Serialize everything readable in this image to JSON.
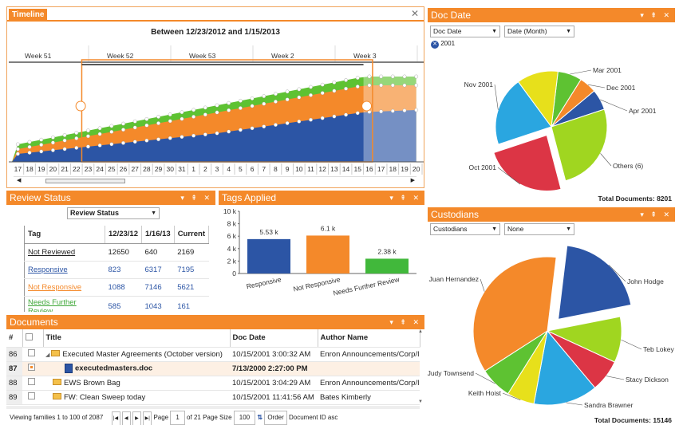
{
  "timeline": {
    "tab": "Timeline",
    "range_title": "Between 12/23/2012 and 1/15/2013",
    "weeks": [
      "Week 51",
      "Week 52",
      "Week 53",
      "Week 2",
      "Week 3"
    ],
    "days": [
      "17",
      "18",
      "19",
      "20",
      "21",
      "22",
      "23",
      "24",
      "25",
      "26",
      "27",
      "28",
      "29",
      "30",
      "31",
      "1",
      "2",
      "3",
      "4",
      "5",
      "6",
      "7",
      "8",
      "9",
      "10",
      "11",
      "12",
      "13",
      "14",
      "15",
      "16",
      "17",
      "18",
      "19",
      "20"
    ]
  },
  "doc_date": {
    "title": "Doc Date",
    "select1": "Doc Date",
    "select2": "Date (Month)",
    "filter_chip": "2001",
    "total_label": "Total Documents:",
    "total_value": "8201",
    "chart_data": {
      "type": "pie",
      "slices": [
        {
          "label": "Mar 2001",
          "value": 7,
          "color": "#5ec232"
        },
        {
          "label": "Dec 2001",
          "value": 5,
          "color": "#f4892a"
        },
        {
          "label": "Apr 2001",
          "value": 6,
          "color": "#2c55a5"
        },
        {
          "label": "Others (6)",
          "value": 26,
          "color": "#a0d620"
        },
        {
          "label": "Oct 2001",
          "value": 24,
          "color": "#dc3545"
        },
        {
          "label": "Nov 2001",
          "value": 20,
          "color": "#2aa6e0"
        },
        {
          "label": "",
          "value": 12,
          "color": "#e7e01b"
        }
      ]
    }
  },
  "review": {
    "title": "Review Status",
    "select": "Review Status",
    "headers": [
      "Tag",
      "12/23/12",
      "1/16/13",
      "Current"
    ],
    "rows": [
      {
        "tag": "Not Reviewed",
        "a": "12650",
        "b": "640",
        "c": "2169",
        "color": "#222"
      },
      {
        "tag": "Responsive",
        "a": "823",
        "b": "6317",
        "c": "7195",
        "color": "#2c55a5"
      },
      {
        "tag": "Not Responsive",
        "a": "1088",
        "b": "7146",
        "c": "5621",
        "color": "#f4892a"
      },
      {
        "tag": "Needs Further Review",
        "a": "585",
        "b": "1043",
        "c": "161",
        "color": "#41a83b"
      }
    ]
  },
  "tags": {
    "title": "Tags Applied",
    "chart_data": {
      "type": "bar",
      "categories": [
        "Responsive",
        "Not Responsive",
        "Needs Further Review"
      ],
      "values": [
        5.53,
        6.1,
        2.38
      ],
      "value_labels": [
        "5.53 k",
        "6.1 k",
        "2.38 k"
      ],
      "colors": [
        "#2c55a5",
        "#f4892a",
        "#41b83b"
      ],
      "yticks": [
        "0",
        "2 k",
        "4 k",
        "6 k",
        "8 k",
        "10 k"
      ],
      "ylim": [
        0,
        10
      ]
    }
  },
  "custodians": {
    "title": "Custodians",
    "select1": "Custodians",
    "select2": "None",
    "total_label": "Total Documents:",
    "total_value": "15146",
    "chart_data": {
      "type": "pie",
      "slices": [
        {
          "label": "John Hodge",
          "value": 20,
          "color": "#2c55a5"
        },
        {
          "label": "Teb Lokey",
          "value": 10,
          "color": "#a0d620"
        },
        {
          "label": "Stacy Dickson",
          "value": 7,
          "color": "#dc3545"
        },
        {
          "label": "Sandra Brawner",
          "value": 14,
          "color": "#2aa6e0"
        },
        {
          "label": "Keith Hoist",
          "value": 6,
          "color": "#e7e01b"
        },
        {
          "label": "Judy Townsend",
          "value": 7,
          "color": "#5ec232"
        },
        {
          "label": "Juan Hernandez",
          "value": 36,
          "color": "#f4892a"
        }
      ]
    }
  },
  "documents": {
    "title": "Documents",
    "headers": [
      "#",
      "",
      "Title",
      "Doc Date",
      "Author Name"
    ],
    "rows": [
      {
        "n": "86",
        "title": "Executed Master Agreements (October version)",
        "date": "10/15/2001 3:00:32 AM",
        "author": "Enron Announcements/Corp/I",
        "icon": "folder"
      },
      {
        "n": "87",
        "title": "executedmasters.doc",
        "date": "7/13/2000 2:27:00 PM",
        "author": "",
        "icon": "doc"
      },
      {
        "n": "88",
        "title": "EWS Brown Bag",
        "date": "10/15/2001 3:04:29 AM",
        "author": "Enron Announcements/Corp/I",
        "icon": "folder"
      },
      {
        "n": "89",
        "title": "FW: Clean Sweep today",
        "date": "10/15/2001 11:41:56 AM",
        "author": "Bates  Kimberly",
        "icon": "folder"
      }
    ],
    "footer": {
      "viewing": "Viewing families 1 to 100 of 2087",
      "page_label": "Page",
      "page": "1",
      "of": "of 21",
      "page_size_label": "Page Size",
      "page_size": "100",
      "order_btn": "Order",
      "order_value": "Document ID asc"
    }
  }
}
